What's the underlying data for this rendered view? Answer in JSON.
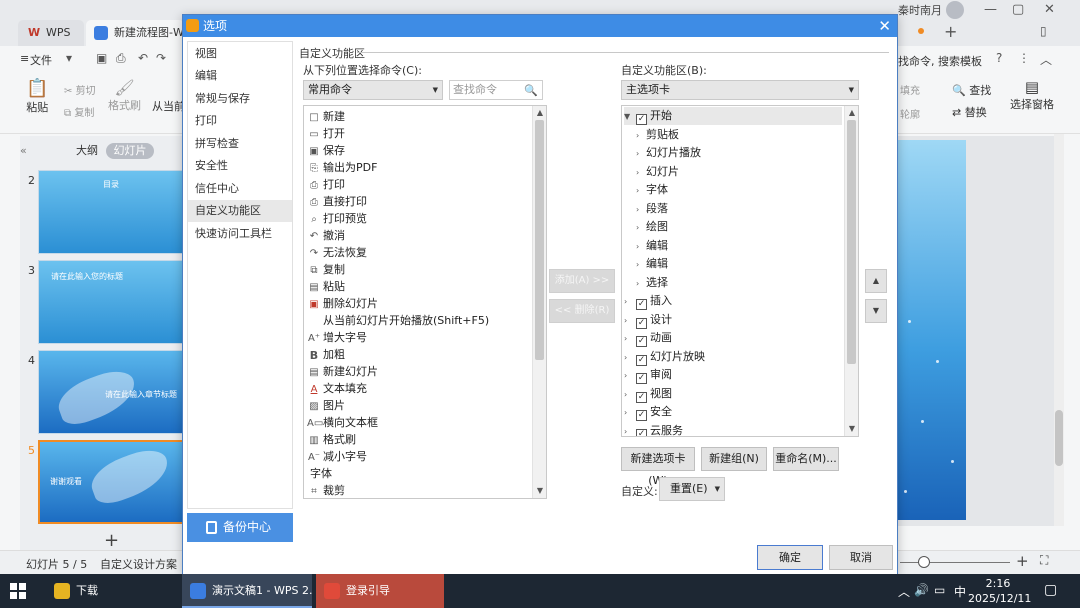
{
  "background_app": {
    "tabs": [
      {
        "label": "WPS"
      },
      {
        "label": "新建流程图-WPS"
      }
    ],
    "user_name": "秦时南月",
    "menu_file": "文件",
    "search_commands": "找命令, 搜索模板",
    "ribbon": {
      "paste": "粘贴",
      "cut": "剪切",
      "copy": "复制",
      "format_painter": "格式刷",
      "from_current": "从当前",
      "fill": "填充",
      "outline": "轮廓",
      "find": "查找",
      "replace": "替换",
      "select_pane": "选择窗格"
    },
    "view_tabs": {
      "outline": "大纲",
      "slides": "幻灯片"
    },
    "thumbnails": [
      {
        "num": "2",
        "title": "目录"
      },
      {
        "num": "3",
        "title": "请在此输入您的标题"
      },
      {
        "num": "4",
        "title": "请在此输入章节标题"
      },
      {
        "num": "5",
        "title": "谢谢观看"
      }
    ],
    "status": {
      "slide_count": "幻灯片 5 / 5",
      "design": "自定义设计方案"
    }
  },
  "dialog": {
    "title": "选项",
    "nav": [
      "视图",
      "编辑",
      "常规与保存",
      "打印",
      "拼写检查",
      "安全性",
      "信任中心",
      "自定义功能区",
      "快速访问工具栏"
    ],
    "nav_active_index": 7,
    "backup_center": "备份中心",
    "section_title": "自定义功能区",
    "choose_from_label": "从下列位置选择命令(C):",
    "choose_from_value": "常用命令",
    "search_placeholder": "查找命令",
    "commands": [
      {
        "label": "新建",
        "icon": "new-icon"
      },
      {
        "label": "打开",
        "icon": "open-icon"
      },
      {
        "label": "保存",
        "icon": "save-icon"
      },
      {
        "label": "输出为PDF",
        "icon": "pdf-icon"
      },
      {
        "label": "打印",
        "icon": "print-icon"
      },
      {
        "label": "直接打印",
        "icon": "direct-print-icon"
      },
      {
        "label": "打印预览",
        "icon": "print-preview-icon"
      },
      {
        "label": "撤消",
        "icon": "undo-icon"
      },
      {
        "label": "无法恢复",
        "icon": "redo-icon"
      },
      {
        "label": "复制",
        "icon": "copy-icon"
      },
      {
        "label": "粘贴",
        "icon": "paste-icon"
      },
      {
        "label": "删除幻灯片",
        "icon": "delete-slide-icon"
      },
      {
        "label": "从当前幻灯片开始播放(Shift+F5)",
        "icon": ""
      },
      {
        "label": "增大字号",
        "icon": "increase-font-icon"
      },
      {
        "label": "加粗",
        "icon": "bold-icon"
      },
      {
        "label": "新建幻灯片",
        "icon": "new-slide-icon"
      },
      {
        "label": "文本填充",
        "icon": "text-fill-icon",
        "submenu": true
      },
      {
        "label": "图片",
        "icon": "picture-icon",
        "submenu": true
      },
      {
        "label": "横向文本框",
        "icon": "textbox-icon"
      },
      {
        "label": "格式刷",
        "icon": "format-painter-icon"
      },
      {
        "label": "减小字号",
        "icon": "decrease-font-icon"
      },
      {
        "label": "字体",
        "icon": "",
        "group": true
      },
      {
        "label": "裁剪",
        "icon": "crop-icon"
      }
    ],
    "add_button": "添加(A) >>",
    "remove_button": "<< 删除(R)",
    "customize_label": "自定义功能区(B):",
    "customize_value": "主选项卡",
    "tree": [
      {
        "label": "开始",
        "level": 0,
        "checked": true,
        "expanded": true,
        "selected": true
      },
      {
        "label": "剪贴板",
        "level": 1
      },
      {
        "label": "幻灯片播放",
        "level": 1
      },
      {
        "label": "幻灯片",
        "level": 1
      },
      {
        "label": "字体",
        "level": 1
      },
      {
        "label": "段落",
        "level": 1
      },
      {
        "label": "绘图",
        "level": 1
      },
      {
        "label": "编辑",
        "level": 1
      },
      {
        "label": "编辑",
        "level": 1
      },
      {
        "label": "选择",
        "level": 1
      },
      {
        "label": "插入",
        "level": 0,
        "checked": true
      },
      {
        "label": "设计",
        "level": 0,
        "checked": true
      },
      {
        "label": "动画",
        "level": 0,
        "checked": true
      },
      {
        "label": "幻灯片放映",
        "level": 0,
        "checked": true
      },
      {
        "label": "审阅",
        "level": 0,
        "checked": true
      },
      {
        "label": "视图",
        "level": 0,
        "checked": true
      },
      {
        "label": "安全",
        "level": 0,
        "checked": true
      },
      {
        "label": "云服务",
        "level": 0,
        "checked": true
      }
    ],
    "new_tab": "新建选项卡(W)",
    "new_group": "新建组(N)",
    "rename": "重命名(M)...",
    "custom_label": "自定义:",
    "reset": "重置(E)",
    "ok": "确定",
    "cancel": "取消"
  },
  "taskbar": {
    "items": [
      {
        "label": "下载"
      },
      {
        "label": "演示文稿1 - WPS 2..."
      },
      {
        "label": "登录引导"
      }
    ],
    "ime": "中",
    "time": "2:16",
    "date": "2025/12/11"
  },
  "colors": {
    "titlebar": "#3e8ce5",
    "backup": "#4a90e2",
    "taskbar": "#1d2733",
    "accent_orange": "#f08b24"
  }
}
